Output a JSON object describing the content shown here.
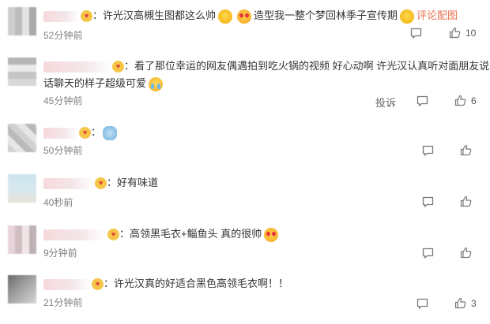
{
  "comments": [
    {
      "text1": "：许光汉高槻生图都这么帅",
      "text2": "造型我一整个梦回林季子宣传期",
      "link": "评论配图",
      "time": "52分钟前",
      "likes": "10"
    },
    {
      "text": "：看了那位幸运的网友偶遇拍到吃火锅的视频 好心动啊 许光汉认真听对面朋友说话聊天的样子超级可爱",
      "time": "45分钟前",
      "report": "投诉",
      "likes": "6"
    },
    {
      "text": "：",
      "time": "50分钟前",
      "likes": ""
    },
    {
      "text": "：好有味道",
      "time": "40秒前",
      "likes": ""
    },
    {
      "text": "：高领黑毛衣+鲻鱼头 真的很帅",
      "time": "9分钟前",
      "likes": ""
    },
    {
      "text": "：许光汉真的好适合黑色高领毛衣啊！！",
      "time": "21分钟前",
      "likes": "3"
    }
  ],
  "icons": {
    "badge": "vip-badge-icon",
    "comment": "comment-icon",
    "like": "thumbs-up-icon"
  },
  "colors": {
    "link": "#eb7350",
    "time": "#808080"
  }
}
